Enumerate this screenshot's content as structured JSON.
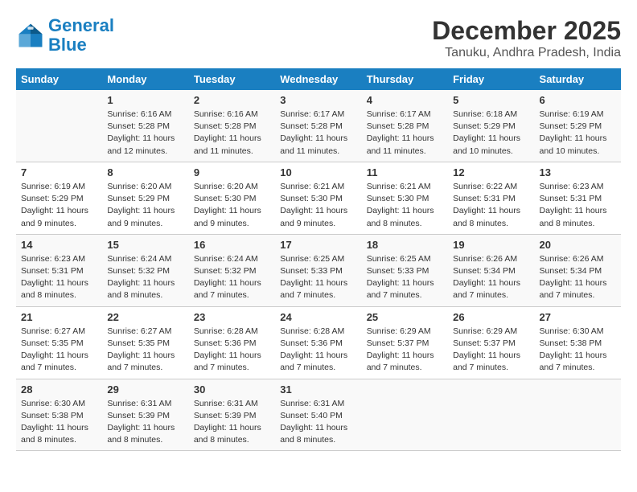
{
  "logo": {
    "line1": "General",
    "line2": "Blue"
  },
  "title": "December 2025",
  "location": "Tanuku, Andhra Pradesh, India",
  "weekdays": [
    "Sunday",
    "Monday",
    "Tuesday",
    "Wednesday",
    "Thursday",
    "Friday",
    "Saturday"
  ],
  "weeks": [
    [
      {
        "day": "",
        "info": ""
      },
      {
        "day": "1",
        "info": "Sunrise: 6:16 AM\nSunset: 5:28 PM\nDaylight: 11 hours\nand 12 minutes."
      },
      {
        "day": "2",
        "info": "Sunrise: 6:16 AM\nSunset: 5:28 PM\nDaylight: 11 hours\nand 11 minutes."
      },
      {
        "day": "3",
        "info": "Sunrise: 6:17 AM\nSunset: 5:28 PM\nDaylight: 11 hours\nand 11 minutes."
      },
      {
        "day": "4",
        "info": "Sunrise: 6:17 AM\nSunset: 5:28 PM\nDaylight: 11 hours\nand 11 minutes."
      },
      {
        "day": "5",
        "info": "Sunrise: 6:18 AM\nSunset: 5:29 PM\nDaylight: 11 hours\nand 10 minutes."
      },
      {
        "day": "6",
        "info": "Sunrise: 6:19 AM\nSunset: 5:29 PM\nDaylight: 11 hours\nand 10 minutes."
      }
    ],
    [
      {
        "day": "7",
        "info": "Sunrise: 6:19 AM\nSunset: 5:29 PM\nDaylight: 11 hours\nand 9 minutes."
      },
      {
        "day": "8",
        "info": "Sunrise: 6:20 AM\nSunset: 5:29 PM\nDaylight: 11 hours\nand 9 minutes."
      },
      {
        "day": "9",
        "info": "Sunrise: 6:20 AM\nSunset: 5:30 PM\nDaylight: 11 hours\nand 9 minutes."
      },
      {
        "day": "10",
        "info": "Sunrise: 6:21 AM\nSunset: 5:30 PM\nDaylight: 11 hours\nand 9 minutes."
      },
      {
        "day": "11",
        "info": "Sunrise: 6:21 AM\nSunset: 5:30 PM\nDaylight: 11 hours\nand 8 minutes."
      },
      {
        "day": "12",
        "info": "Sunrise: 6:22 AM\nSunset: 5:31 PM\nDaylight: 11 hours\nand 8 minutes."
      },
      {
        "day": "13",
        "info": "Sunrise: 6:23 AM\nSunset: 5:31 PM\nDaylight: 11 hours\nand 8 minutes."
      }
    ],
    [
      {
        "day": "14",
        "info": "Sunrise: 6:23 AM\nSunset: 5:31 PM\nDaylight: 11 hours\nand 8 minutes."
      },
      {
        "day": "15",
        "info": "Sunrise: 6:24 AM\nSunset: 5:32 PM\nDaylight: 11 hours\nand 8 minutes."
      },
      {
        "day": "16",
        "info": "Sunrise: 6:24 AM\nSunset: 5:32 PM\nDaylight: 11 hours\nand 7 minutes."
      },
      {
        "day": "17",
        "info": "Sunrise: 6:25 AM\nSunset: 5:33 PM\nDaylight: 11 hours\nand 7 minutes."
      },
      {
        "day": "18",
        "info": "Sunrise: 6:25 AM\nSunset: 5:33 PM\nDaylight: 11 hours\nand 7 minutes."
      },
      {
        "day": "19",
        "info": "Sunrise: 6:26 AM\nSunset: 5:34 PM\nDaylight: 11 hours\nand 7 minutes."
      },
      {
        "day": "20",
        "info": "Sunrise: 6:26 AM\nSunset: 5:34 PM\nDaylight: 11 hours\nand 7 minutes."
      }
    ],
    [
      {
        "day": "21",
        "info": "Sunrise: 6:27 AM\nSunset: 5:35 PM\nDaylight: 11 hours\nand 7 minutes."
      },
      {
        "day": "22",
        "info": "Sunrise: 6:27 AM\nSunset: 5:35 PM\nDaylight: 11 hours\nand 7 minutes."
      },
      {
        "day": "23",
        "info": "Sunrise: 6:28 AM\nSunset: 5:36 PM\nDaylight: 11 hours\nand 7 minutes."
      },
      {
        "day": "24",
        "info": "Sunrise: 6:28 AM\nSunset: 5:36 PM\nDaylight: 11 hours\nand 7 minutes."
      },
      {
        "day": "25",
        "info": "Sunrise: 6:29 AM\nSunset: 5:37 PM\nDaylight: 11 hours\nand 7 minutes."
      },
      {
        "day": "26",
        "info": "Sunrise: 6:29 AM\nSunset: 5:37 PM\nDaylight: 11 hours\nand 7 minutes."
      },
      {
        "day": "27",
        "info": "Sunrise: 6:30 AM\nSunset: 5:38 PM\nDaylight: 11 hours\nand 7 minutes."
      }
    ],
    [
      {
        "day": "28",
        "info": "Sunrise: 6:30 AM\nSunset: 5:38 PM\nDaylight: 11 hours\nand 8 minutes."
      },
      {
        "day": "29",
        "info": "Sunrise: 6:31 AM\nSunset: 5:39 PM\nDaylight: 11 hours\nand 8 minutes."
      },
      {
        "day": "30",
        "info": "Sunrise: 6:31 AM\nSunset: 5:39 PM\nDaylight: 11 hours\nand 8 minutes."
      },
      {
        "day": "31",
        "info": "Sunrise: 6:31 AM\nSunset: 5:40 PM\nDaylight: 11 hours\nand 8 minutes."
      },
      {
        "day": "",
        "info": ""
      },
      {
        "day": "",
        "info": ""
      },
      {
        "day": "",
        "info": ""
      }
    ]
  ]
}
